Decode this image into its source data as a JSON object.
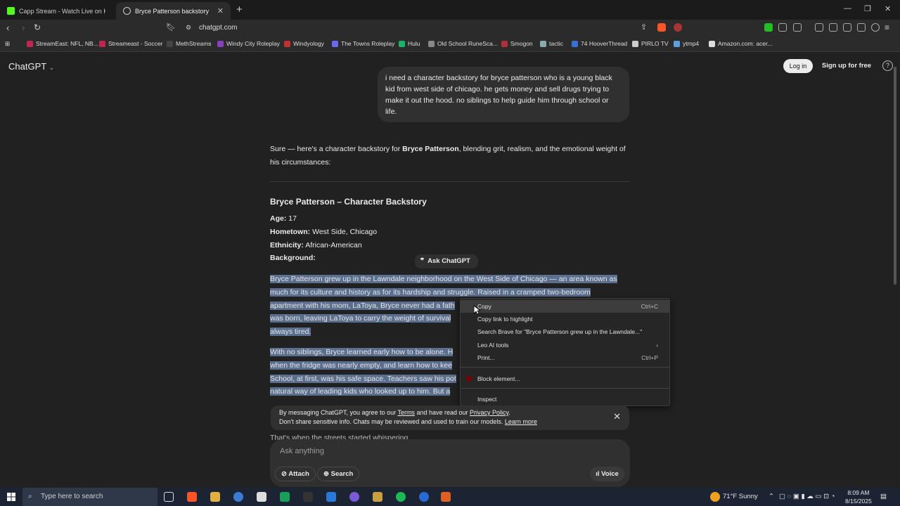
{
  "browser": {
    "tabs": [
      {
        "label": "Capp Stream - Watch Live on Kic"
      },
      {
        "label": "Bryce Patterson backstory"
      }
    ],
    "url": "chatgpt.com",
    "bookmarks": [
      "StreamEast: NFL, NB...",
      "Streameast - Soccer",
      "MethStreams",
      "Windy City Roleplay",
      "Windyology",
      "The Towns Roleplay",
      "Hulu",
      "Old School RuneSca...",
      "Smogon",
      "tactic",
      "74 HooverThread",
      "PIRLO TV",
      "ytmp4",
      "Amazon.com: acer..."
    ]
  },
  "header": {
    "brand": "ChatGPT",
    "login": "Log in",
    "signup": "Sign up for free",
    "help": "?"
  },
  "user_message": "i need a character backstory for bryce patterson who is a young black kid from west side of chicago. he gets money and sell drugs trying to make it out the hood. no siblings to help guide him through school or life.",
  "response": {
    "intro_a": "Sure — here's a character backstory for ",
    "intro_name": "Bryce Patterson",
    "intro_b": ", blending grit, realism, and the emotional weight of his circumstances:",
    "heading": "Bryce Patterson – Character Backstory",
    "age_label": "Age:",
    "age": "17",
    "hometown_label": "Hometown:",
    "hometown": "West Side, Chicago",
    "ethnicity_label": "Ethnicity:",
    "ethnicity": "African-American",
    "background_label": "Background:",
    "p1_lines": [
      "Bryce Patterson grew up in the Lawndale neighborhood on the West Side of Chicago — an area known as",
      "much for its culture and history as for its hardship and struggle. Raised in a cramped two-bedroom",
      "apartment with his mom, LaToya, Bryce never had a fath",
      "was born, leaving LaToya to carry the weight of survival",
      "always tired."
    ],
    "p2_lines": [
      "With no siblings, Bryce learned early how to be alone. H",
      "when the fridge was nearly empty, and learn how to kee",
      "School, at first, was his safe space. Teachers saw his pot",
      "natural way of leading kids who looked up to him. But a"
    ],
    "peek": "That's when the streets started whispering"
  },
  "ask_chatgpt": "Ask ChatGPT",
  "context_menu": {
    "items": [
      {
        "label": "Copy",
        "shortcut": "Ctrl+C"
      },
      {
        "label": "Copy link to highlight",
        "shortcut": ""
      },
      {
        "label": "Search Brave for \"Bryce Patterson grew up in the Lawndale...\"",
        "shortcut": ""
      },
      {
        "label": "Leo AI tools",
        "shortcut": "›"
      },
      {
        "label": "Print...",
        "shortcut": "Ctrl+P"
      },
      {
        "label": "Block element...",
        "shortcut": ""
      },
      {
        "label": "Inspect",
        "shortcut": ""
      }
    ]
  },
  "consent": {
    "line1_a": "By messaging ChatGPT, you agree to our ",
    "terms": "Terms",
    "line1_b": " and have read our ",
    "privacy": "Privacy Policy",
    "line1_c": ".",
    "line2": "Don't share sensitive info. Chats may be reviewed and used to train our models. ",
    "learn_more": "Learn more"
  },
  "composer": {
    "placeholder": "Ask anything",
    "attach": "Attach",
    "search": "Search",
    "voice": "Voice"
  },
  "taskbar": {
    "search_placeholder": "Type here to search",
    "weather": "71°F  Sunny",
    "time": "8:09 AM",
    "date": "8/15/2025"
  }
}
